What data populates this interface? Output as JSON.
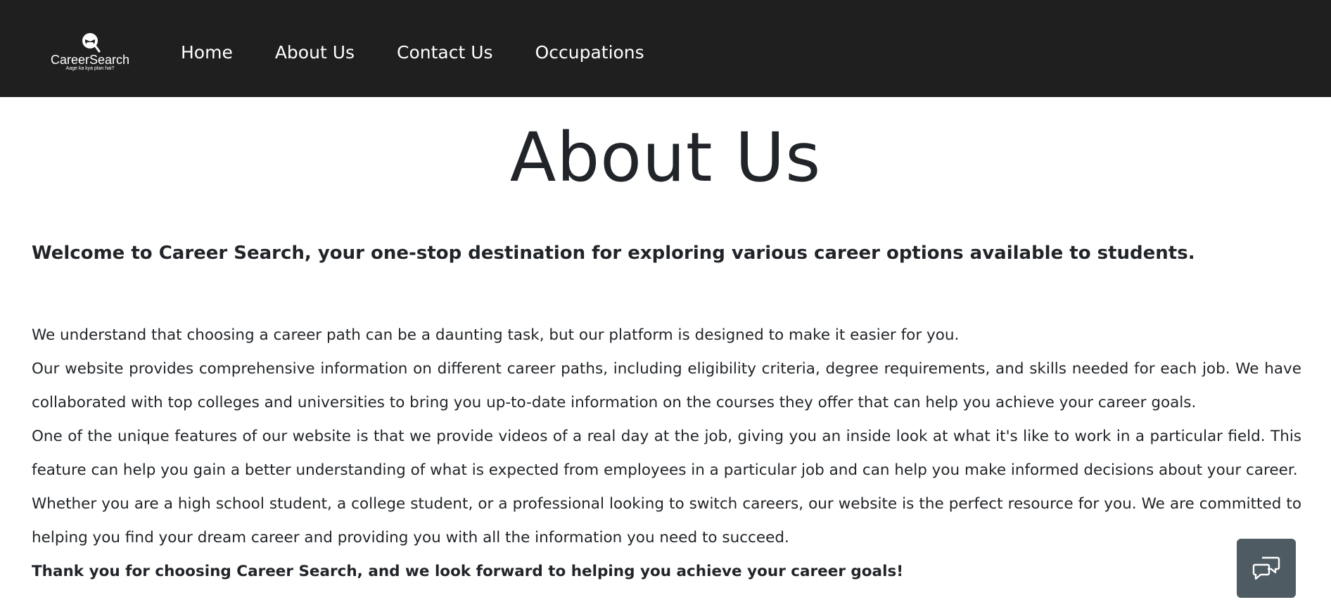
{
  "brand": {
    "name": "CareerSearch",
    "tagline": "Aage ka kya plan hai?"
  },
  "nav": {
    "items": [
      {
        "label": "Home"
      },
      {
        "label": "About Us"
      },
      {
        "label": "Contact Us"
      },
      {
        "label": "Occupations"
      }
    ]
  },
  "main": {
    "title": "About Us",
    "welcome": "Welcome to Career Search, your one-stop destination for exploring various career options available to students.",
    "paragraphs": [
      "We understand that choosing a career path can be a daunting task, but our platform is designed to make it easier for you.",
      "Our website provides comprehensive information on different career paths, including eligibility criteria, degree requirements, and skills needed for each job. We have collaborated with top colleges and universities to bring you up-to-date information on the courses they offer that can help you achieve your career goals.",
      "One of the unique features of our website is that we provide videos of a real day at the job, giving you an inside look at what it's like to work in a particular field. This feature can help you gain a better understanding of what is expected from employees in a particular job and can help you make informed decisions about your career.",
      "Whether you are a high school student, a college student, or a professional looking to switch careers, our website is the perfect resource for you. We are committed to helping you find your dream career and providing you with all the information you need to succeed."
    ],
    "thanks": "Thank you for choosing Career Search, and we look forward to helping you achieve your career goals!"
  },
  "chat": {
    "icon": "chat-bubbles-icon",
    "background": "#4f5b62"
  },
  "colors": {
    "navbar": "#1e1f1e",
    "text": "#212529"
  }
}
